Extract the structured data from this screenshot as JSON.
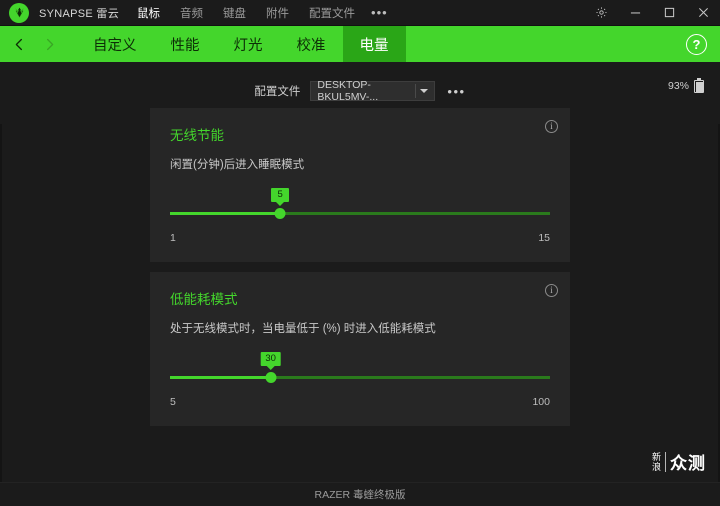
{
  "titlebar": {
    "brand": "SYNAPSE 雷云",
    "nav": [
      {
        "label": "鼠标",
        "active": true
      },
      {
        "label": "音频",
        "active": false
      },
      {
        "label": "键盘",
        "active": false
      },
      {
        "label": "附件",
        "active": false
      },
      {
        "label": "配置文件",
        "active": false
      }
    ],
    "more_label": "•••",
    "window_controls": {
      "settings": "gear-icon",
      "minimize": "minimize-icon",
      "maximize": "maximize-icon",
      "close": "close-icon"
    }
  },
  "tabbar": {
    "back": "chevron-left-icon",
    "forward": "chevron-right-icon",
    "tabs": [
      {
        "label": "自定义",
        "active": false
      },
      {
        "label": "性能",
        "active": false
      },
      {
        "label": "灯光",
        "active": false
      },
      {
        "label": "校准",
        "active": false
      },
      {
        "label": "电量",
        "active": true
      }
    ],
    "help_label": "?",
    "accent": "#44d62c",
    "active_tab_bg": "#2aa617"
  },
  "profile": {
    "label": "配置文件",
    "selected": "DESKTOP-BKUL5MV-...",
    "more_label": "•••"
  },
  "battery": {
    "percent": "93%",
    "icon": "battery-icon"
  },
  "cards": [
    {
      "title": "无线节能",
      "description": "闲置(分钟)后进入睡眠模式",
      "value": "5",
      "min": "1",
      "max": "15",
      "fill_ratio": 0.29,
      "info_icon": "info-icon"
    },
    {
      "title": "低能耗模式",
      "description": "处于无线模式时，当电量低于 (%) 时进入低能耗模式",
      "value": "30",
      "min": "5",
      "max": "100",
      "fill_ratio": 0.265,
      "info_icon": "info-icon"
    }
  ],
  "footer": {
    "device": "RAZER 毒蝰终极版"
  },
  "watermark": {
    "left_line1": "新",
    "left_line2": "浪",
    "right": "众测"
  }
}
